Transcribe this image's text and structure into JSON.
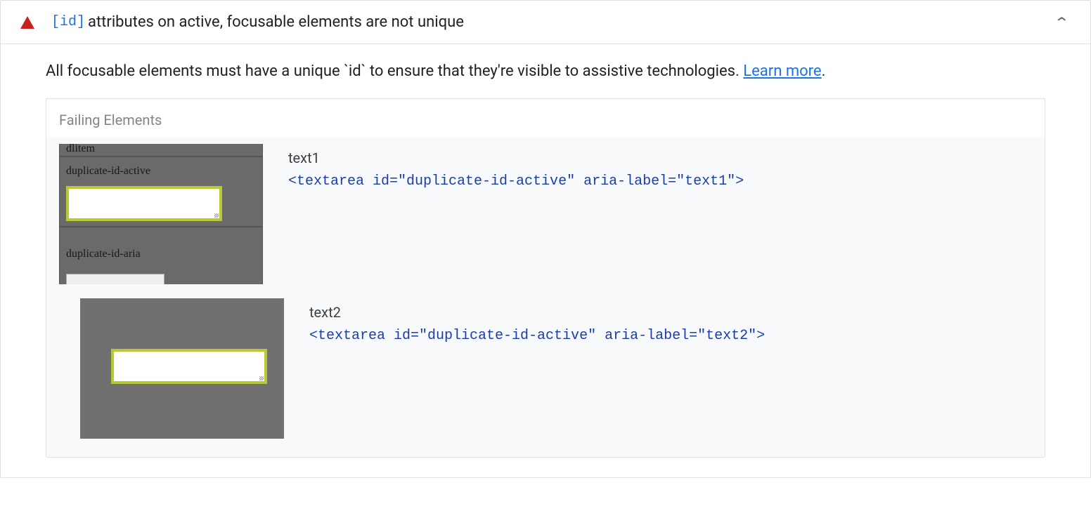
{
  "header": {
    "code_label": "[id]",
    "title_text": " attributes on active, focusable elements are not unique"
  },
  "description": {
    "text": "All focusable elements must have a unique `id` to ensure that they're visible to assistive technologies. ",
    "learn_more": "Learn more",
    "period": "."
  },
  "failing": {
    "header": "Failing Elements",
    "items": [
      {
        "label": "text1",
        "code": "<textarea id=\"duplicate-id-active\" aria-label=\"text1\">"
      },
      {
        "label": "text2",
        "code": "<textarea id=\"duplicate-id-active\" aria-label=\"text2\">"
      }
    ]
  },
  "thumb1": {
    "label_top": "dlitem",
    "label_mid": "duplicate-id-active",
    "label_bot": "duplicate-id-aria"
  }
}
